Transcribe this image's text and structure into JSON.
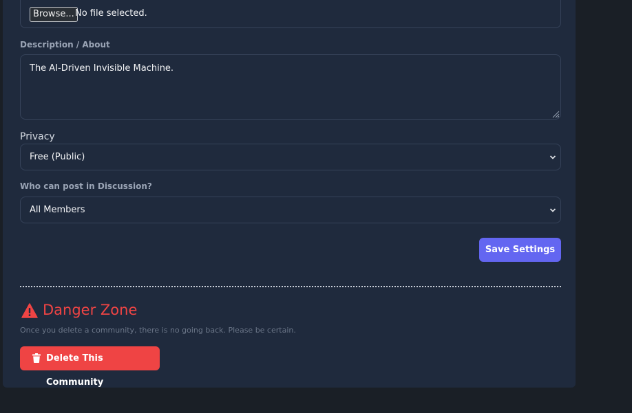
{
  "upload": {
    "button_label": "Browse...",
    "status": "No file selected."
  },
  "description": {
    "label": "Description / About",
    "value": "The AI-Driven Invisible Machine."
  },
  "privacy": {
    "label": "Privacy",
    "selected": "Free (Public)"
  },
  "discussion": {
    "label": "Who can post in Discussion?",
    "selected": "All Members"
  },
  "actions": {
    "save_label": "Save Settings"
  },
  "danger_zone": {
    "title": "Danger Zone",
    "warning": "Once you delete a community, there is no going back. Please be certain.",
    "delete_label": "Delete This Community",
    "icon": "warning-triangle-icon",
    "color": "#ef4444"
  },
  "colors": {
    "panel": "#1f2a3d",
    "background": "#1a1f26",
    "accent": "#6366f1",
    "danger": "#ef4444"
  }
}
